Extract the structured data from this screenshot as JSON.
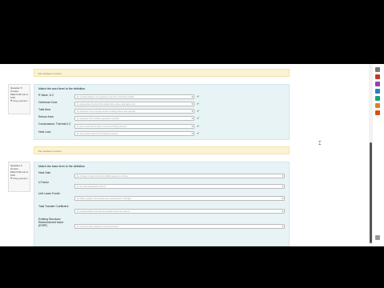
{
  "q1": {
    "feedback": "Your answer is correct.",
    "info": [
      "Question 5",
      "Correct",
      "Mark 6.00 out of 6.00"
    ],
    "flag_label": "Flag question",
    "prompt": "Match the word level to the definition",
    "rows": [
      {
        "label": "R Value, K-2",
        "value": "the overall resistance of a component element to heat flow (m²K/W)"
      },
      {
        "label": "Overhead Zone",
        "value": "the space above the top of the window frame where solar gains occur"
      },
      {
        "label": "Total Area",
        "value": "the total area of the envelope element including frames and openings"
      },
      {
        "label": "Sensor Area",
        "value": "the total area of the surfaces exposed to sunshine"
      },
      {
        "label": "Conductance, Thermal K.2",
        "value": "the rate of heat flow through a unit area of building element"
      },
      {
        "label": "Heat Loss",
        "value": "the rate at which heat is lost through an element"
      }
    ]
  },
  "q2": {
    "feedback": "Your answer is correct.",
    "info": [
      "Question 6",
      "Correct",
      "Mark 5.00 out of 5.00"
    ],
    "flag_label": "Flag question",
    "prompt": "Match the base term to the definition",
    "rows": [
      {
        "label": "Heat Gain",
        "value": "the increase in heat content of a building space per unit time"
      },
      {
        "label": "U Factor",
        "value": "the thermal transmittance (W/m²K)"
      },
      {
        "label": "Unit Lower Fourth",
        "value": "the bottom quarter of the window area measured from sill height"
      },
      {
        "label": "Total Transfer Coefficient",
        "value": "the overall coefficient for total heat transfer across the element"
      },
      {
        "label": "Existing Structural Reinforcement factor (ESRF)",
        "value": "the correction factor applied to existing structures"
      }
    ]
  },
  "colors": {
    "accent": "#2e7d32",
    "feedback_bg": "#fcf3d4",
    "question_bg": "#e7f3f5"
  }
}
